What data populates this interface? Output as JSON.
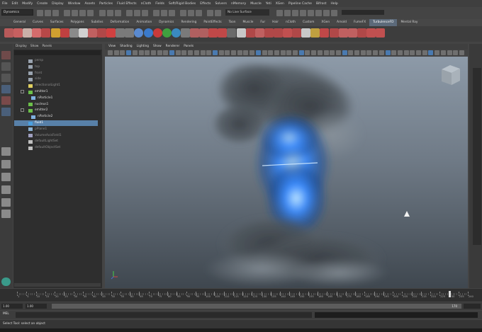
{
  "menubar": {
    "items": [
      "File",
      "Edit",
      "Modify",
      "Create",
      "Display",
      "Window",
      "Assets",
      "Particles",
      "Fluid Effects",
      "nCloth",
      "Fields",
      "Soft/Rigid Bodies",
      "Effects",
      "Solvers",
      "nMemory",
      "Muscle",
      "Yeti",
      "XGen",
      "Pipeline Cache",
      "Bifrost",
      "Help"
    ]
  },
  "statusline": {
    "mode": "Dynamics",
    "live_surface": "No Live Surface"
  },
  "shelf": {
    "tabs": [
      "General",
      "Curves",
      "Surfaces",
      "Polygons",
      "Subdivs",
      "Deformation",
      "Animation",
      "Dynamics",
      "Rendering",
      "PaintEffects",
      "Toon",
      "Muscle",
      "Fur",
      "Hair",
      "nCloth",
      "Custom",
      "XGen",
      "Arnold",
      "FumeFX",
      "TurbulenceFD",
      "Mental Ray"
    ],
    "active_tab_index": 19
  },
  "outliner": {
    "menu": [
      "Display",
      "Show",
      "Panels"
    ],
    "items": [
      {
        "label": "persp",
        "icon": "camera-icon",
        "indent": 0,
        "selected": false
      },
      {
        "label": "top",
        "icon": "camera-icon",
        "indent": 0,
        "selected": false
      },
      {
        "label": "front",
        "icon": "camera-icon",
        "indent": 0,
        "selected": false
      },
      {
        "label": "side",
        "icon": "camera-icon",
        "indent": 0,
        "selected": false
      },
      {
        "label": "directionalLight1",
        "icon": "light-icon",
        "indent": 0,
        "selected": false
      },
      {
        "label": "emitter1",
        "icon": "emitter-icon",
        "indent": 0,
        "selected": false
      },
      {
        "label": "nParticle1",
        "icon": "particle-icon",
        "indent": 1,
        "selected": false
      },
      {
        "label": "nucleus1",
        "icon": "nucleus-icon",
        "indent": 0,
        "selected": false
      },
      {
        "label": "emitter2",
        "icon": "emitter-icon",
        "indent": 0,
        "selected": false
      },
      {
        "label": "nParticle2",
        "icon": "particle-icon",
        "indent": 1,
        "selected": false
      },
      {
        "label": "fluid1",
        "icon": "fluid-icon",
        "indent": 0,
        "selected": true
      },
      {
        "label": "pPlane1",
        "icon": "mesh-icon",
        "indent": 0,
        "selected": false
      },
      {
        "label": "VolumeAxisField1",
        "icon": "field-icon",
        "indent": 0,
        "selected": false
      },
      {
        "label": "defaultLightSet",
        "icon": "set-icon",
        "indent": 0,
        "selected": false
      },
      {
        "label": "defaultObjectSet",
        "icon": "set-icon",
        "indent": 0,
        "selected": false
      }
    ]
  },
  "viewport": {
    "menu": [
      "View",
      "Shading",
      "Lighting",
      "Show",
      "Renderer",
      "Panels"
    ]
  },
  "timeline": {
    "ticks": [
      "1",
      "5",
      "10",
      "15",
      "20",
      "25",
      "30",
      "35",
      "40",
      "45",
      "50",
      "55",
      "60",
      "65",
      "70",
      "75",
      "80",
      "85",
      "90",
      "95",
      "100",
      "105",
      "110",
      "115",
      "120",
      "125",
      "130",
      "135",
      "140",
      "145",
      "150",
      "155",
      "160",
      "165",
      "170",
      "175",
      "180",
      "185",
      "190",
      "195",
      "200",
      "205",
      "210",
      "215",
      "220",
      "225",
      "230",
      "235",
      "240"
    ],
    "current_frame": "170"
  },
  "range": {
    "start": "1.00",
    "end_inner": "1.00",
    "slider_end": "170"
  },
  "cmdline": {
    "label": "MEL"
  },
  "helpline": {
    "text": "Select Tool: select an object"
  },
  "colors": {
    "selection": "#5880a8",
    "viewport_top": "#8d9aa8",
    "viewport_bottom": "#3f474f",
    "smoke_glow": "#3b8cff"
  }
}
